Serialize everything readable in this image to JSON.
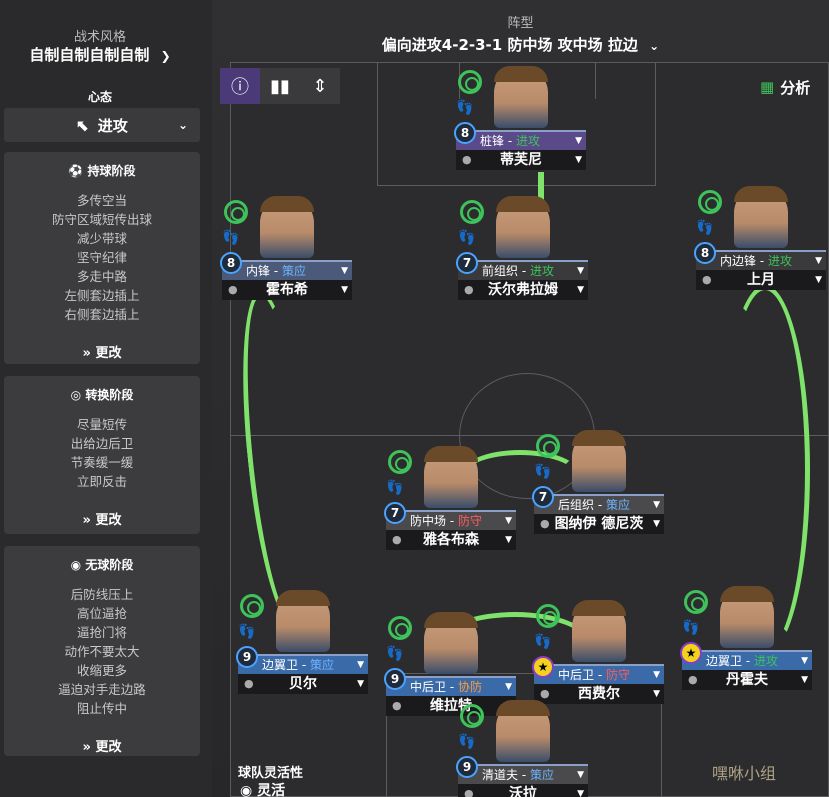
{
  "sidebar": {
    "tactic_label": "战术风格",
    "tactic_value": "自制自制自制自制",
    "mentality_label": "心态",
    "mentality_value": "进攻",
    "panels": [
      {
        "title": "持球阶段",
        "items": [
          "多传空当",
          "防守区域短传出球",
          "减少带球",
          "坚守纪律",
          "多走中路",
          "左侧套边插上",
          "右侧套边插上"
        ],
        "change": "更改"
      },
      {
        "title": "转换阶段",
        "items": [
          "尽量短传",
          "出给边后卫",
          "节奏缓一缓",
          "立即反击"
        ],
        "change": "更改"
      },
      {
        "title": "无球阶段",
        "items": [
          "后防线压上",
          "高位逼抢",
          "逼抢门将",
          "动作不要太大",
          "收缩更多",
          "逼迫对手走边路",
          "阻止传中"
        ],
        "change": "更改"
      }
    ],
    "flex_label": "球队灵活性",
    "flex_value": "灵活"
  },
  "header": {
    "formation_label": "阵型",
    "formation_value": "偏向进攻4-2-3-1 防中场 攻中场 拉边",
    "analysis_label": "分析"
  },
  "colors": {
    "accent_green": "#7ee26b",
    "attack": "#3ec25a",
    "support": "#4aa3ff",
    "defend": "#ff5c5c"
  },
  "players": [
    {
      "id": "st",
      "num": "8",
      "role": "桩锋",
      "duty": "进攻",
      "duty_color": "#3ec25a",
      "name": "蒂芙尼",
      "role_bg": "#5a4a8a"
    },
    {
      "id": "lw",
      "num": "8",
      "role": "内锋",
      "duty": "策应",
      "duty_color": "#6fb4ff",
      "name": "霍布希",
      "role_bg": "#4a5a78"
    },
    {
      "id": "am",
      "num": "7",
      "role": "前组织",
      "duty": "进攻",
      "duty_color": "#3ec25a",
      "name": "沃尔弗拉姆",
      "role_bg": "#3a3a3c"
    },
    {
      "id": "rw",
      "num": "8",
      "role": "内边锋",
      "duty": "进攻",
      "duty_color": "#3ec25a",
      "name": "上月",
      "role_bg": "#3a3a3c"
    },
    {
      "id": "dm",
      "num": "7",
      "role": "防中场",
      "duty": "防守",
      "duty_color": "#ff5c5c",
      "name": "雅各布森",
      "role_bg": "#4a4a4c"
    },
    {
      "id": "dlp",
      "num": "7",
      "role": "后组织",
      "duty": "策应",
      "duty_color": "#6fb4ff",
      "name": "图纳伊 德尼茨",
      "role_bg": "#4a4a4c"
    },
    {
      "id": "lb",
      "num": "9",
      "role": "边翼卫",
      "duty": "策应",
      "duty_color": "#6fb4ff",
      "name": "贝尔",
      "role_bg": "#3a6aa8"
    },
    {
      "id": "lcb",
      "num": "9",
      "role": "中后卫",
      "duty": "协防",
      "duty_color": "#ff9a3c",
      "name": "维拉特",
      "role_bg": "#3a6aa8"
    },
    {
      "id": "rcb",
      "num": "★",
      "role": "中后卫",
      "duty": "防守",
      "duty_color": "#ff5c5c",
      "name": "西费尔",
      "role_bg": "#3a6aa8"
    },
    {
      "id": "rb",
      "num": "★",
      "role": "边翼卫",
      "duty": "进攻",
      "duty_color": "#3ec25a",
      "name": "丹霍夫",
      "role_bg": "#3a6aa8"
    },
    {
      "id": "gk",
      "num": "9",
      "role": "清道夫",
      "duty": "策应",
      "duty_color": "#6fb4ff",
      "name": "沃拉",
      "role_bg": "#4a4a4c"
    }
  ],
  "watermark": "嘿咻小组"
}
